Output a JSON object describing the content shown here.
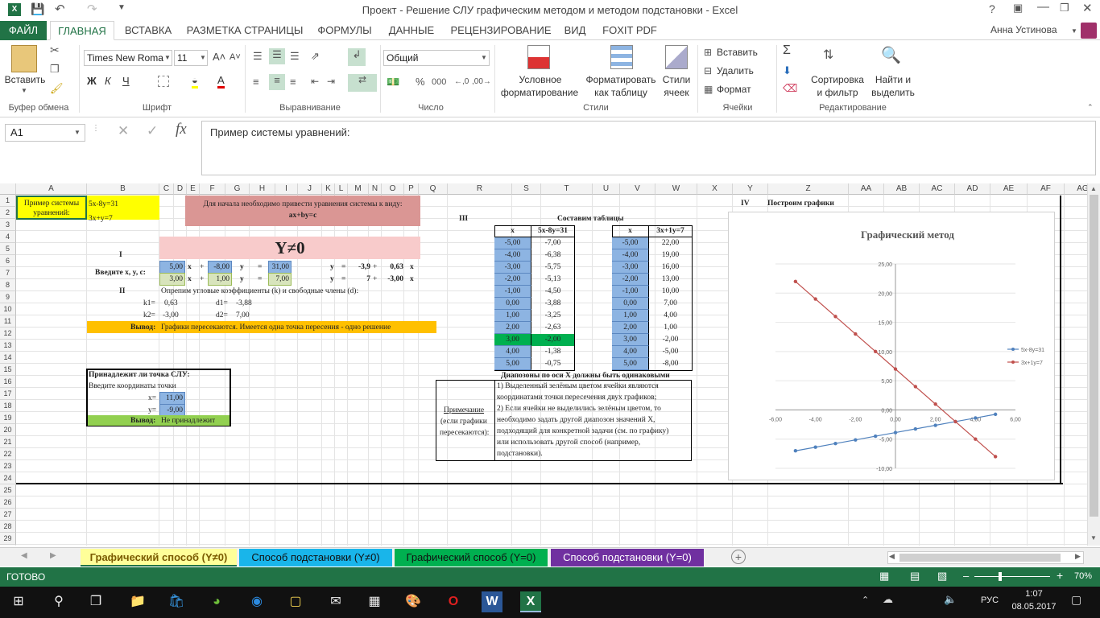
{
  "window": {
    "title": "Проект - Решение СЛУ графическим методом и методом подстановки - Excel",
    "help": "?",
    "user": "Анна Устинова"
  },
  "ribbon_tabs": [
    "ФАЙЛ",
    "ГЛАВНАЯ",
    "ВСТАВКА",
    "РАЗМЕТКА СТРАНИЦЫ",
    "ФОРМУЛЫ",
    "ДАННЫЕ",
    "РЕЦЕНЗИРОВАНИЕ",
    "ВИД",
    "FOXIT PDF"
  ],
  "ribbon": {
    "paste": "Вставить",
    "font_name": "Times New Roma",
    "font_size": "11",
    "number_format": "Общий",
    "cond_format_1": "Условное",
    "cond_format_2": "форматирование",
    "format_table_1": "Форматировать",
    "format_table_2": "как таблицу",
    "styles_1": "Стили",
    "styles_2": "ячеек",
    "insert": "Вставить",
    "delete": "Удалить",
    "format": "Формат",
    "sort_1": "Сортировка",
    "sort_2": "и фильтр",
    "find_1": "Найти и",
    "find_2": "выделить",
    "groups": [
      "Буфер обмена",
      "Шрифт",
      "Выравнивание",
      "Число",
      "Стили",
      "Ячейки",
      "Редактирование"
    ]
  },
  "formula_bar": {
    "name_box": "A1",
    "fx": "fx",
    "content": "Пример системы уравнений:"
  },
  "sheet": {
    "columns": [
      "A",
      "B",
      "C",
      "D",
      "E",
      "F",
      "G",
      "H",
      "I",
      "J",
      "K",
      "L",
      "M",
      "N",
      "O",
      "P",
      "Q",
      "R",
      "S",
      "T",
      "U",
      "V",
      "W",
      "X",
      "Y",
      "Z",
      "AA",
      "AB",
      "AC",
      "AD",
      "AE",
      "AF",
      "AG"
    ],
    "rows": [
      "1",
      "2",
      "3",
      "4",
      "5",
      "6",
      "7",
      "8",
      "9",
      "10",
      "11",
      "12",
      "13",
      "14",
      "15",
      "16",
      "17",
      "18",
      "19",
      "20",
      "21",
      "22",
      "23",
      "24",
      "25",
      "26",
      "27",
      "28",
      "29"
    ],
    "a1": "Пример системы уравнений:",
    "eq1": "5x-8y=31",
    "eq2": "3x+y=7",
    "intro": "Для начала необходимо привести уравнения системы к виду:",
    "form": "ax+by=c",
    "yneq": "Y≠0",
    "sec1": "I",
    "sec2": "II",
    "sec3": "III",
    "sec4": "IV",
    "enter_xyc": "Введите x, y, c:",
    "r6": {
      "a": "5,00",
      "x": "x",
      "plus": "+",
      "b": "-8,00",
      "y": "y",
      "eq": "=",
      "c": "31,00",
      "y2": "y",
      "eq2": "=",
      "k": "-3,9",
      "p2": "+",
      "d": "0,63",
      "x2": "x"
    },
    "r7": {
      "a": "3,00",
      "x": "x",
      "plus": "+",
      "b": "1,00",
      "y": "y",
      "eq": "=",
      "c": "7,00",
      "y2": "y",
      "eq2": "=",
      "k": "7",
      "p2": "+",
      "d": "-3,00",
      "x2": "x"
    },
    "determine": "Опрепим угловые коэффициенты (k) и свободные члены (d):",
    "k1": "k1=",
    "k1v": "0,63",
    "d1": "d1=",
    "d1v": "-3,88",
    "k2": "k2=",
    "k2v": "-3,00",
    "d2": "d2=",
    "d2v": "7,00",
    "conclusion_label": "Вывод:",
    "conclusion": "Графики пересекаются. Имеется одна точка пересения - одно решение",
    "tables_title": "Составим таблицы",
    "t1_headers": [
      "x",
      "5x-8y=31"
    ],
    "t1_rows": [
      [
        "-5,00",
        "-7,00"
      ],
      [
        "-4,00",
        "-6,38"
      ],
      [
        "-3,00",
        "-5,75"
      ],
      [
        "-2,00",
        "-5,13"
      ],
      [
        "-1,00",
        "-4,50"
      ],
      [
        "0,00",
        "-3,88"
      ],
      [
        "1,00",
        "-3,25"
      ],
      [
        "2,00",
        "-2,63"
      ],
      [
        "3,00",
        "-2,00"
      ],
      [
        "4,00",
        "-1,38"
      ],
      [
        "5,00",
        "-0,75"
      ]
    ],
    "t2_headers": [
      "x",
      "3x+1y=7"
    ],
    "t2_rows": [
      [
        "-5,00",
        "22,00"
      ],
      [
        "-4,00",
        "19,00"
      ],
      [
        "-3,00",
        "16,00"
      ],
      [
        "-2,00",
        "13,00"
      ],
      [
        "-1,00",
        "10,00"
      ],
      [
        "0,00",
        "7,00"
      ],
      [
        "1,00",
        "4,00"
      ],
      [
        "2,00",
        "1,00"
      ],
      [
        "3,00",
        "-2,00"
      ],
      [
        "4,00",
        "-5,00"
      ],
      [
        "5,00",
        "-8,00"
      ]
    ],
    "range_note": "Диапозоны по оси Х должны быть одинаковыми",
    "note_label_1": "Примечание",
    "note_label_2": "(если графики",
    "note_label_3": "пересекаются):",
    "note_lines": [
      "1) Выделенный зелёным цветом ячейки являются",
      "координатами точки пересечения двух графиков;",
      "2) Если ячейки не выделились зелёным цветом, то",
      "необходимо задать другой диапозон значений X,",
      "подходящий для конкретной задачи (см. по графику)",
      "или использовать другой способ (например,",
      "подстановки)."
    ],
    "check_title": "Принадлежит ли точка СЛУ:",
    "check_enter": "Введите координаты точки",
    "cx_label": "x=",
    "cx": "11,00",
    "cy_label": "y=",
    "cy": "-9,00",
    "check_conclusion_label": "Вывод:",
    "check_conclusion": "Не принадлежит",
    "build_graphs": "Построим графики"
  },
  "chart_data": {
    "type": "line",
    "title": "Графический метод",
    "x": [
      -5,
      -4,
      -3,
      -2,
      -1,
      0,
      1,
      2,
      3,
      4,
      5
    ],
    "series": [
      {
        "name": "5x-8y=31",
        "color": "#4f81bd",
        "values": [
          -7,
          -6.38,
          -5.75,
          -5.13,
          -4.5,
          -3.88,
          -3.25,
          -2.63,
          -2,
          -1.38,
          -0.75
        ]
      },
      {
        "name": "3x+1y=7",
        "color": "#c0504d",
        "values": [
          22,
          19,
          16,
          13,
          10,
          7,
          4,
          1,
          -2,
          -5,
          -8
        ]
      }
    ],
    "xlim": [
      -6,
      6
    ],
    "ylim": [
      -10,
      25
    ],
    "xticks": [
      "-6,00",
      "-4,00",
      "-2,00",
      "0,00",
      "2,00",
      "4,00",
      "6,00"
    ],
    "yticks": [
      "25,00",
      "20,00",
      "15,00",
      "10,00",
      "5,00",
      "0,00",
      "-5,00",
      "-10,00"
    ],
    "legend": "right"
  },
  "sheet_tabs": [
    {
      "label": "Графический способ (Y≠0)",
      "bg": "#ffff99",
      "color": "#7a5a00"
    },
    {
      "label": "Способ подстановки (Y≠0)",
      "bg": "#19b5ea",
      "color": "#111"
    },
    {
      "label": "Графический способ (Y=0)",
      "bg": "#00b050",
      "color": "#111"
    },
    {
      "label": "Способ подстановки (Y=0)",
      "bg": "#7030a0",
      "color": "#fff"
    }
  ],
  "status": {
    "ready": "ГОТОВО",
    "zoom": "70%"
  },
  "taskbar": {
    "lang": "РУС",
    "time": "1:07",
    "date": "08.05.2017"
  }
}
